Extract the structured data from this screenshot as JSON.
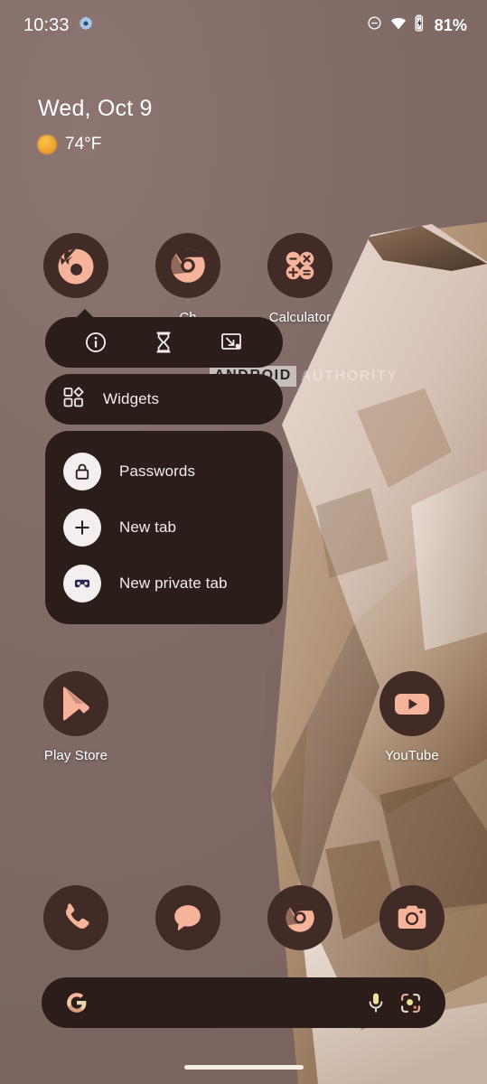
{
  "status_bar": {
    "clock": "10:33",
    "battery_percent": "81%",
    "icons": [
      "settings-gear-icon",
      "do-not-disturb-icon",
      "wifi-icon",
      "battery-charging-icon"
    ]
  },
  "date_widget": {
    "date": "Wed, Oct 9",
    "temperature": "74°F",
    "weather_icon": "sun-icon"
  },
  "apps": [
    {
      "label": "Firefox",
      "icon": "firefox-icon",
      "label_visible": false
    },
    {
      "label": "Ch",
      "icon": "chrome-icon",
      "label_visible": true
    },
    {
      "label": "Calculator",
      "icon": "calculator-icon",
      "label_visible": true
    },
    {
      "label": "Play Store",
      "icon": "play-store-icon",
      "label_visible": true
    },
    {
      "label": "YouTube",
      "icon": "youtube-icon",
      "label_visible": true
    }
  ],
  "popup_menu": {
    "actions": [
      {
        "name": "app-info-icon",
        "label": "App info"
      },
      {
        "name": "app-timer-hourglass-icon",
        "label": "App timer"
      },
      {
        "name": "split-screen-icon",
        "label": "Split screen"
      }
    ],
    "widgets_row": {
      "label": "Widgets",
      "icon": "widgets-icon"
    },
    "shortcuts": [
      {
        "label": "Passwords",
        "icon": "lock-icon"
      },
      {
        "label": "New tab",
        "icon": "plus-icon"
      },
      {
        "label": "New private tab",
        "icon": "mask-icon"
      }
    ]
  },
  "watermark": {
    "part_one": "ANDROID",
    "part_two": "AUTHORITY"
  },
  "dock": [
    {
      "label": "Phone",
      "icon": "phone-icon"
    },
    {
      "label": "Messages",
      "icon": "messages-icon"
    },
    {
      "label": "Chrome",
      "icon": "chrome-icon"
    },
    {
      "label": "Camera",
      "icon": "camera-icon"
    }
  ],
  "search_bar": {
    "logo": "google-g-icon",
    "mic": "microphone-icon",
    "lens": "google-lens-icon",
    "placeholder": ""
  },
  "navigation": {
    "gesture_pill": "home-gesture-pill"
  },
  "colors": {
    "wallpaper_base": "#816c68",
    "icon_bg": "#402b26",
    "icon_glyph": "#f5b39a",
    "popup_bg": "#2a1d1a",
    "text_primary": "#ffffff",
    "bubble_bg": "#f3efee"
  }
}
